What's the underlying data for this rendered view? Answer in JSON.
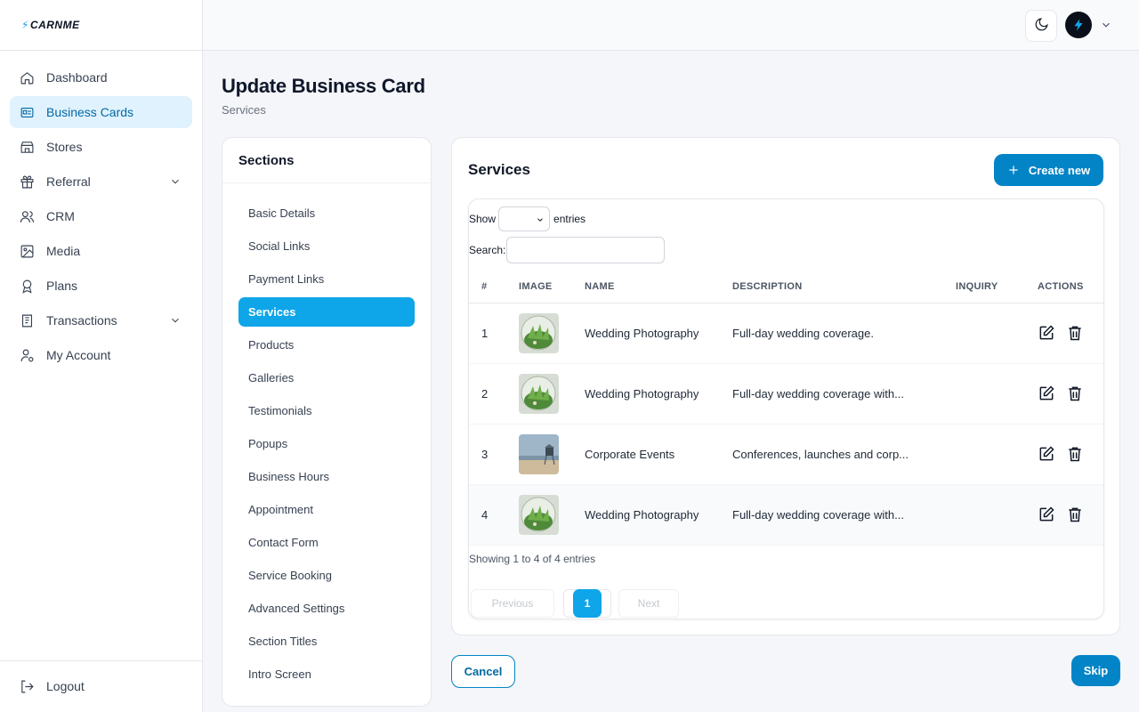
{
  "brand": {
    "logo_text": "CARNME",
    "bolt": "⚡"
  },
  "sidebar": {
    "items": [
      {
        "label": "Dashboard",
        "icon": "home-icon"
      },
      {
        "label": "Business Cards",
        "icon": "id-card-icon",
        "active": true
      },
      {
        "label": "Stores",
        "icon": "store-icon"
      },
      {
        "label": "Referral",
        "icon": "gift-icon",
        "expandable": true
      },
      {
        "label": "CRM",
        "icon": "users-icon"
      },
      {
        "label": "Media",
        "icon": "image-icon"
      },
      {
        "label": "Plans",
        "icon": "award-icon"
      },
      {
        "label": "Transactions",
        "icon": "receipt-icon",
        "expandable": true
      },
      {
        "label": "My Account",
        "icon": "user-cog-icon"
      }
    ],
    "logout": {
      "label": "Logout",
      "icon": "logout-icon"
    }
  },
  "topbar": {
    "theme_icon": "moon-icon",
    "avatar_icon": "bolt-avatar-icon"
  },
  "page": {
    "title": "Update Business Card",
    "subtitle": "Services"
  },
  "sections": {
    "title": "Sections",
    "items": [
      "Basic Details",
      "Social Links",
      "Payment Links",
      "Services",
      "Products",
      "Galleries",
      "Testimonials",
      "Popups",
      "Business Hours",
      "Appointment",
      "Contact Form",
      "Service Booking",
      "Advanced Settings",
      "Section Titles",
      "Intro Screen"
    ],
    "active": "Services"
  },
  "services": {
    "title": "Services",
    "create_label": "Create new",
    "show_label": "Show",
    "entries_label": "entries",
    "search_label": "Search:",
    "columns": [
      "#",
      "IMAGE",
      "NAME",
      "DESCRIPTION",
      "INQUIRY",
      "ACTIONS"
    ],
    "rows": [
      {
        "num": "1",
        "image": "plant-thumbnail",
        "name": "Wedding Photography",
        "description": "Full-day wedding coverage.",
        "inquiry": ""
      },
      {
        "num": "2",
        "image": "plant-thumbnail",
        "name": "Wedding Photography",
        "description": "Full-day wedding coverage with...",
        "inquiry": ""
      },
      {
        "num": "3",
        "image": "beach-thumbnail",
        "name": "Corporate Events",
        "description": "Conferences, launches and corp...",
        "inquiry": ""
      },
      {
        "num": "4",
        "image": "plant-thumbnail",
        "name": "Wedding Photography",
        "description": "Full-day wedding coverage with...",
        "inquiry": ""
      }
    ],
    "info": "Showing 1 to 4 of 4 entries",
    "pagination": {
      "previous": "Previous",
      "current": "1",
      "next": "Next"
    }
  },
  "footer": {
    "cancel_label": "Cancel",
    "skip_label": "Skip"
  },
  "colors": {
    "accent": "#0ea5e9",
    "primary_button": "#0284c7",
    "active_nav_bg": "#e0f2fe"
  }
}
